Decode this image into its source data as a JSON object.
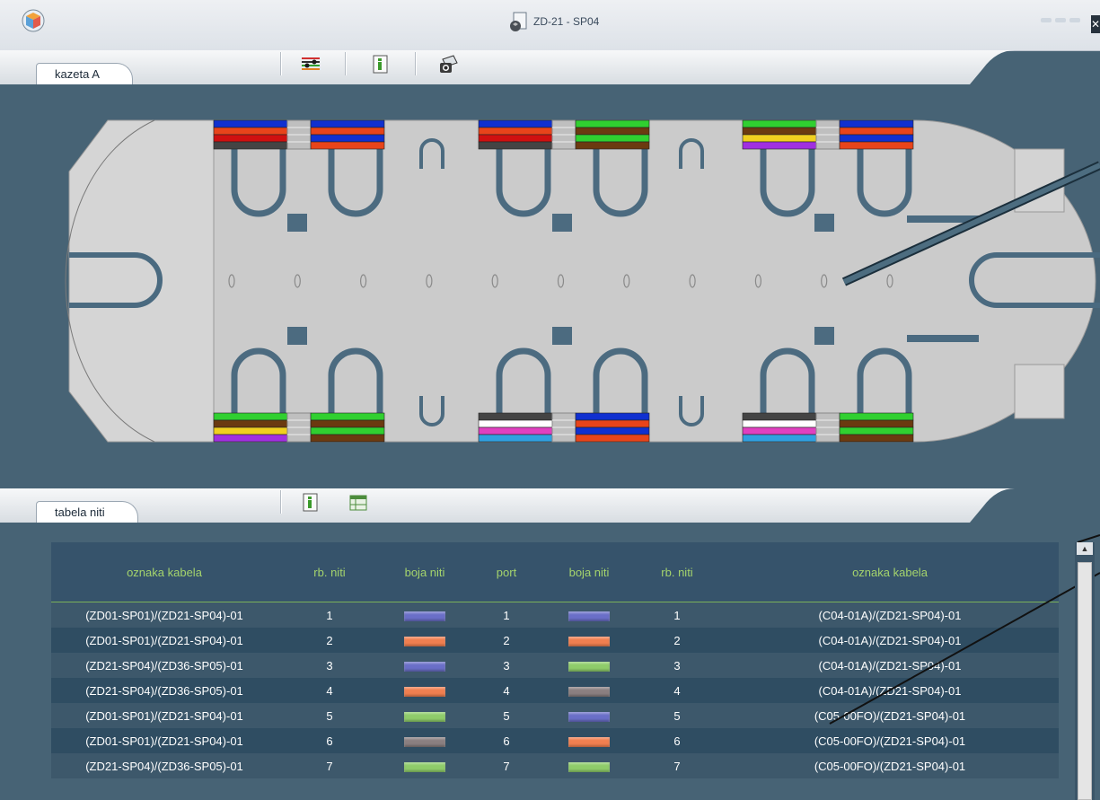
{
  "window": {
    "title": "ZD-21 - SP04"
  },
  "cassette_panel": {
    "tab_label": "kazeta A"
  },
  "table_panel": {
    "tab_label": "tabela niti"
  },
  "icons": {
    "app": "cube-logo-icon",
    "window_doc": "document-cube-icon",
    "layers": "fiber-layers-icon",
    "info": "info-icon",
    "camera": "camera-icon",
    "info2": "info-icon",
    "grid": "table-grid-icon"
  },
  "colors": {
    "blue": "#6a6fc8",
    "orange": "#f07f50",
    "green": "#8fcc6a",
    "gray": "#8a7f80",
    "header_text": "#a4d36c",
    "background": "#476375"
  },
  "cassette": {
    "top_splices": [
      {
        "left": [
          "#1030d0",
          "#e8441a",
          "#d01010",
          "#444444"
        ],
        "right": [
          "#1030d0",
          "#e8441a",
          "#1030d0",
          "#e8441a"
        ]
      },
      {
        "left": [
          "#1030d0",
          "#e8441a",
          "#d01010",
          "#444444"
        ],
        "right": [
          "#30d030",
          "#6b3a10",
          "#30d030",
          "#6b3a10"
        ]
      },
      {
        "left": [
          "#30d030",
          "#6b3a10",
          "#f0d020",
          "#a030e0"
        ],
        "right": [
          "#1030d0",
          "#e8441a",
          "#1030d0",
          "#e8441a"
        ]
      }
    ],
    "bottom_splices": [
      {
        "left": [
          "#30d030",
          "#6b3a10",
          "#f0d020",
          "#a030e0"
        ],
        "right": [
          "#30d030",
          "#6b3a10",
          "#30d030",
          "#6b3a10"
        ]
      },
      {
        "left": [
          "#444444",
          "#ffffff",
          "#e040c0",
          "#30a0e0"
        ],
        "right": [
          "#1030d0",
          "#e8441a",
          "#1030d0",
          "#e8441a"
        ]
      },
      {
        "left": [
          "#444444",
          "#ffffff",
          "#e040c0",
          "#30a0e0"
        ],
        "right": [
          "#30d030",
          "#6b3a10",
          "#30d030",
          "#6b3a10"
        ]
      }
    ]
  },
  "table": {
    "headers": [
      "oznaka kabela",
      "rb. niti",
      "boja niti",
      "port",
      "boja niti",
      "rb. niti",
      "oznaka kabela"
    ],
    "rows": [
      {
        "cable_a": "(ZD01-SP01)/(ZD21-SP04)-01",
        "fiber_a": "1",
        "color_a": "#6a6fc8",
        "port": "1",
        "color_b": "#6a6fc8",
        "fiber_b": "1",
        "cable_b": "(C04-01A)/(ZD21-SP04)-01"
      },
      {
        "cable_a": "(ZD01-SP01)/(ZD21-SP04)-01",
        "fiber_a": "2",
        "color_a": "#f07f50",
        "port": "2",
        "color_b": "#f07f50",
        "fiber_b": "2",
        "cable_b": "(C04-01A)/(ZD21-SP04)-01"
      },
      {
        "cable_a": "(ZD21-SP04)/(ZD36-SP05)-01",
        "fiber_a": "3",
        "color_a": "#6a6fc8",
        "port": "3",
        "color_b": "#8fcc6a",
        "fiber_b": "3",
        "cable_b": "(C04-01A)/(ZD21-SP04)-01"
      },
      {
        "cable_a": "(ZD21-SP04)/(ZD36-SP05)-01",
        "fiber_a": "4",
        "color_a": "#f07f50",
        "port": "4",
        "color_b": "#8a7f80",
        "fiber_b": "4",
        "cable_b": "(C04-01A)/(ZD21-SP04)-01"
      },
      {
        "cable_a": "(ZD01-SP01)/(ZD21-SP04)-01",
        "fiber_a": "5",
        "color_a": "#8fcc6a",
        "port": "5",
        "color_b": "#6a6fc8",
        "fiber_b": "5",
        "cable_b": "(C05-00FO)/(ZD21-SP04)-01"
      },
      {
        "cable_a": "(ZD01-SP01)/(ZD21-SP04)-01",
        "fiber_a": "6",
        "color_a": "#8a7f80",
        "port": "6",
        "color_b": "#f07f50",
        "fiber_b": "6",
        "cable_b": "(C05-00FO)/(ZD21-SP04)-01"
      },
      {
        "cable_a": "(ZD21-SP04)/(ZD36-SP05)-01",
        "fiber_a": "7",
        "color_a": "#8fcc6a",
        "port": "7",
        "color_b": "#8fcc6a",
        "fiber_b": "7",
        "cable_b": "(C05-00FO)/(ZD21-SP04)-01"
      }
    ]
  }
}
